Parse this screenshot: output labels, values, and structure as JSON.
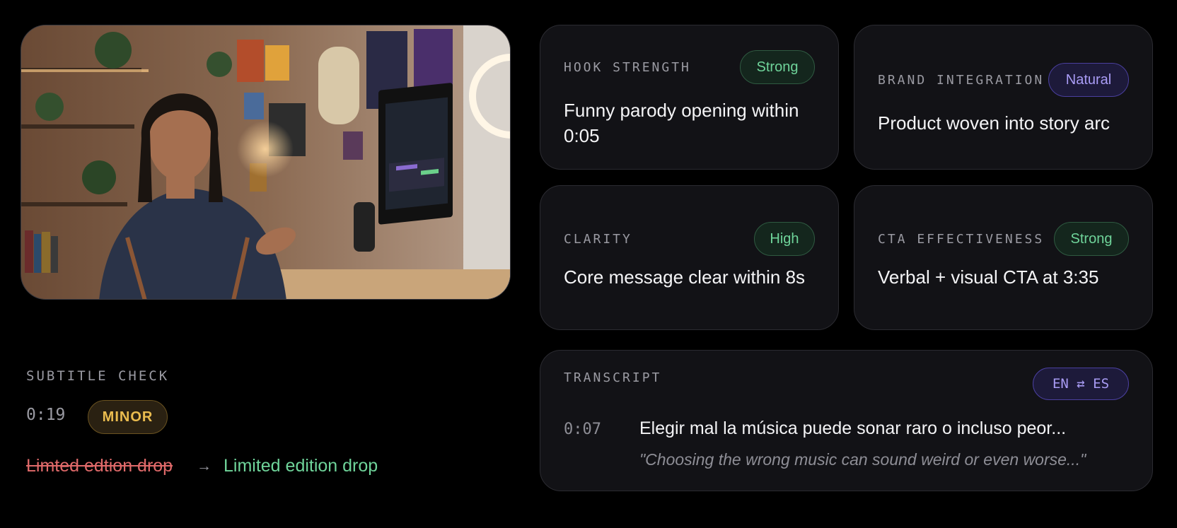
{
  "video": {
    "icon": "video-thumbnail"
  },
  "cards": [
    {
      "label": "HOOK STRENGTH",
      "badge": "Strong",
      "badge_color": "green",
      "value": "Funny parody opening within 0:05"
    },
    {
      "label": "BRAND INTEGRATION",
      "badge": "Natural",
      "badge_color": "purple",
      "value": "Product woven into story arc"
    },
    {
      "label": "CLARITY",
      "badge": "High",
      "badge_color": "green",
      "value": "Core message clear within 8s"
    },
    {
      "label": "CTA EFFECTIVENESS",
      "badge": "Strong",
      "badge_color": "green",
      "value": "Verbal + visual CTA at 3:35"
    }
  ],
  "subtitle_check": {
    "label": "SUBTITLE CHECK",
    "time": "0:19",
    "severity": "MINOR",
    "original": "Limted edtion drop",
    "arrow": "→",
    "corrected": "Limited edition drop"
  },
  "transcript": {
    "label": "TRANSCRIPT",
    "language_toggle": "EN ⇄ ES",
    "time": "0:07",
    "text_es": "Elegir mal la música puede sonar raro o incluso peor...",
    "text_en": "\"Choosing the wrong music can sound weird or even worse...\""
  },
  "colors": {
    "background": "#000000",
    "card_bg": "#121216",
    "green": "#6fd49a",
    "purple": "#a99cf5",
    "amber": "#eabc4f",
    "red": "#e06a6a"
  }
}
